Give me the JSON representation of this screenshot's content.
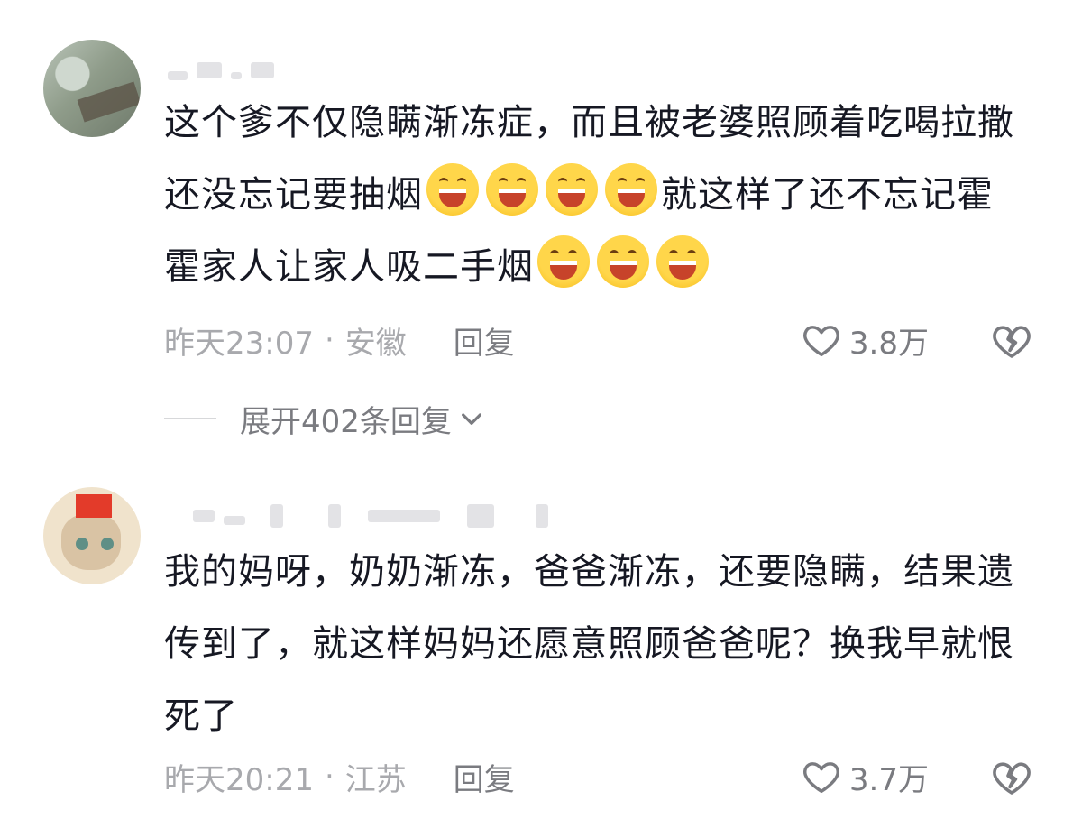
{
  "comments": [
    {
      "text_parts": [
        "这个爹不仅隐瞒渐冻症，而且被老婆照顾着吃喝拉撒还没忘记要抽烟",
        "就这样了还不忘记霍霍家人让家人吸二手烟"
      ],
      "time": "昨天23:07",
      "location": "安徽",
      "reply_label": "回复",
      "likes": "3.8万",
      "expand_label": "展开402条回复"
    },
    {
      "text": "我的妈呀，奶奶渐冻，爸爸渐冻，还要隐瞒，结果遗传到了，就这样妈妈还愿意照顾爸爸呢？换我早就恨死了",
      "time": "昨天20:21",
      "location": "江苏",
      "reply_label": "回复",
      "likes": "3.7万"
    }
  ],
  "icons": {
    "emoji": "grinning-face-icon",
    "like": "heart-outline-icon",
    "dislike": "broken-heart-icon",
    "expand": "chevron-down-icon"
  },
  "colors": {
    "text": "#161823",
    "meta": "#a8a9ad",
    "action": "#7a7b80"
  }
}
